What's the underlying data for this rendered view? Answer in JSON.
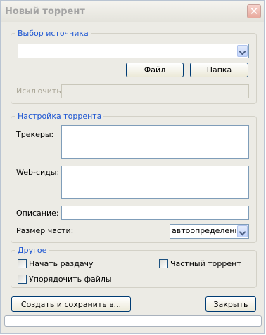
{
  "window": {
    "title": "Новый торрент",
    "close_glyph": "✕"
  },
  "source_group": {
    "legend": "Выбор источника",
    "path_value": "",
    "file_button": "Файл",
    "folder_button": "Папка",
    "exclude_label": "Исключить:",
    "exclude_value": ""
  },
  "torrent_group": {
    "legend": "Настройка торрента",
    "trackers_label": "Трекеры:",
    "trackers_value": "",
    "webseeds_label": "Web-сиды:",
    "webseeds_value": "",
    "description_label": "Описание:",
    "description_value": "",
    "piece_size_label": "Размер части:",
    "piece_size_value": "автоопределение"
  },
  "other_group": {
    "legend": "Другое",
    "start_seeding_label": "Начать раздачу",
    "start_seeding_checked": false,
    "private_label": "Частный торрент",
    "private_checked": false,
    "order_files_label": "Упорядочить файлы",
    "order_files_checked": false
  },
  "footer": {
    "create_save_button": "Создать и сохранить в...",
    "close_button": "Закрыть",
    "progress_fraction": 0
  },
  "colors": {
    "legend_text": "#1c55d2",
    "window_bg": "#ecebe5",
    "field_border": "#7f9db9"
  }
}
